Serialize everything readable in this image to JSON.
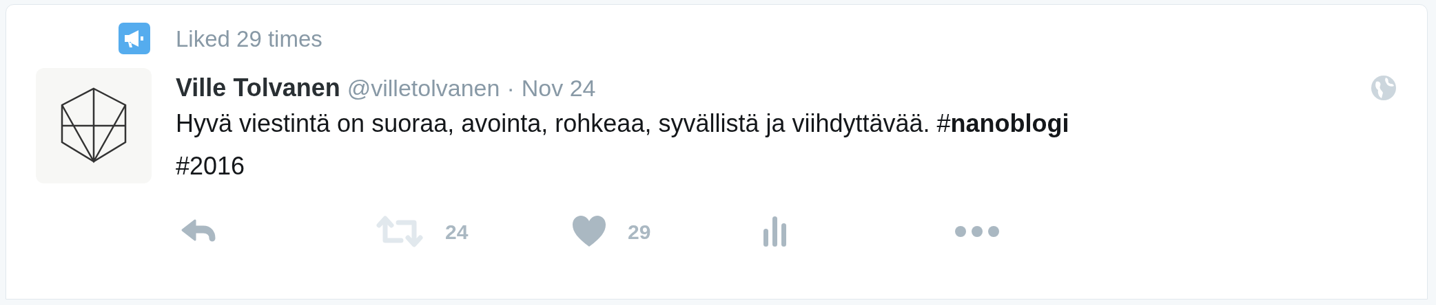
{
  "context": {
    "label": "Liked 29 times"
  },
  "tweet": {
    "name": "Ville Tolvanen",
    "handle": "@villetolvanen",
    "separator": "·",
    "date": "Nov 24",
    "text": "Hyvä viestintä on suoraa, avointa, rohkeaa, syvällistä ja viihdyttävää. #**nanoblogi** #2016"
  },
  "actions": [
    {
      "kind": "reply",
      "disabled": false
    },
    {
      "kind": "retweet",
      "count": "24",
      "disabled": true
    },
    {
      "kind": "like",
      "count": "29",
      "disabled": false
    },
    {
      "kind": "analytics",
      "disabled": false
    },
    {
      "kind": "more",
      "disabled": false
    }
  ]
}
